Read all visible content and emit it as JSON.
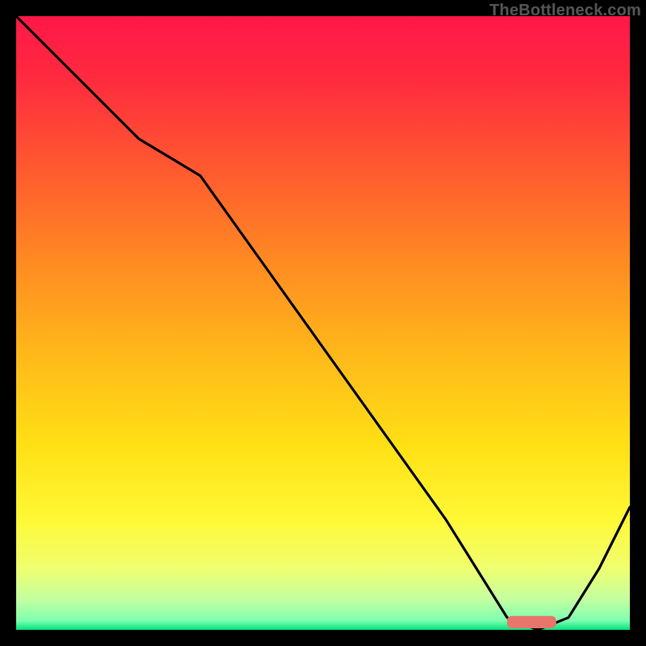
{
  "watermark": "TheBottleneck.com",
  "chart_data": {
    "type": "line",
    "title": "",
    "xlabel": "",
    "ylabel": "",
    "xlim": [
      0,
      100
    ],
    "ylim": [
      0,
      100
    ],
    "grid": false,
    "legend": false,
    "annotations": [],
    "background": {
      "type": "vertical-gradient",
      "description": "red through orange/yellow to green bottom, bottleneck heatmap style",
      "stops": [
        {
          "offset": 0.0,
          "color": "#ff1748"
        },
        {
          "offset": 0.1,
          "color": "#ff2a3f"
        },
        {
          "offset": 0.25,
          "color": "#ff5a2f"
        },
        {
          "offset": 0.4,
          "color": "#ff8a22"
        },
        {
          "offset": 0.55,
          "color": "#ffb81a"
        },
        {
          "offset": 0.7,
          "color": "#ffe015"
        },
        {
          "offset": 0.82,
          "color": "#fff835"
        },
        {
          "offset": 0.9,
          "color": "#f0ff70"
        },
        {
          "offset": 0.95,
          "color": "#c4ffa0"
        },
        {
          "offset": 0.985,
          "color": "#7effb0"
        },
        {
          "offset": 1.0,
          "color": "#00e07e"
        }
      ]
    },
    "series": [
      {
        "name": "bottleneck-curve",
        "x": [
          0,
          10,
          20,
          25,
          30,
          40,
          50,
          60,
          70,
          75,
          80,
          85,
          90,
          95,
          100
        ],
        "y": [
          100,
          90,
          80,
          77,
          74,
          60,
          46,
          32,
          18,
          10,
          2,
          0,
          2,
          10,
          20
        ],
        "note": "y is percent height from bottom; minimum near x≈82–87 with a short flat segment at y≈0"
      }
    ],
    "marker": {
      "name": "optimal-range",
      "shape": "rounded-bar",
      "color": "#e8756b",
      "x_start": 80,
      "x_end": 88,
      "y": 0.5,
      "height": 2
    }
  }
}
